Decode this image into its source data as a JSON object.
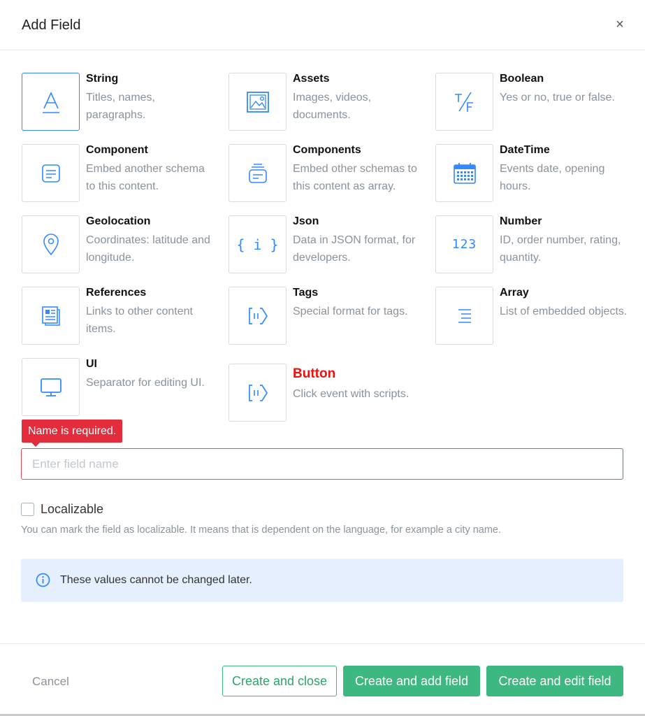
{
  "dialog": {
    "title": "Add Field",
    "close_glyph": "×"
  },
  "field_types": [
    {
      "name": "String",
      "description": "Titles, names, paragraphs.",
      "icon": "string-icon",
      "selected": true
    },
    {
      "name": "Assets",
      "description": "Images, videos, documents.",
      "icon": "image-icon"
    },
    {
      "name": "Boolean",
      "description": "Yes or no, true or false.",
      "icon": "boolean-icon"
    },
    {
      "name": "Component",
      "description": "Embed another schema to this content.",
      "icon": "component-icon"
    },
    {
      "name": "Components",
      "description": "Embed other schemas to this content as array.",
      "icon": "components-icon"
    },
    {
      "name": "DateTime",
      "description": "Events date, opening hours.",
      "icon": "calendar-icon"
    },
    {
      "name": "Geolocation",
      "description": "Coordinates: latitude and longitude.",
      "icon": "location-pin-icon"
    },
    {
      "name": "Json",
      "description": "Data in JSON format, for developers.",
      "icon": "json-icon",
      "glyph": "{ i }"
    },
    {
      "name": "Number",
      "description": "ID, order number, rating, quantity.",
      "icon": "number-icon",
      "glyph": "123"
    },
    {
      "name": "References",
      "description": "Links to other content items.",
      "icon": "references-icon"
    },
    {
      "name": "Tags",
      "description": "Special format for tags.",
      "icon": "tags-icon"
    },
    {
      "name": "Array",
      "description": "List of embedded objects.",
      "icon": "array-icon"
    },
    {
      "name": "UI",
      "description": "Separator for editing UI.",
      "icon": "monitor-icon"
    },
    {
      "name": "Button",
      "description": "Click event with scripts.",
      "icon": "button-tag-icon"
    }
  ],
  "name_field": {
    "error": "Name is required.",
    "placeholder": "Enter field name",
    "value": ""
  },
  "localizable": {
    "label": "Localizable",
    "checked": false,
    "hint": "You can mark the field as localizable. It means that is dependent on the language, for example a city name."
  },
  "info": {
    "text": "These values cannot be changed later.",
    "icon": "info-icon"
  },
  "footer": {
    "cancel_label": "Cancel",
    "create_close_label": "Create and close",
    "create_add_label": "Create and add field",
    "create_edit_label": "Create and edit field"
  },
  "colors": {
    "accent": "#3389ff",
    "success": "#3eb881",
    "danger": "#e32d3c",
    "info_bg": "#e5effd"
  }
}
